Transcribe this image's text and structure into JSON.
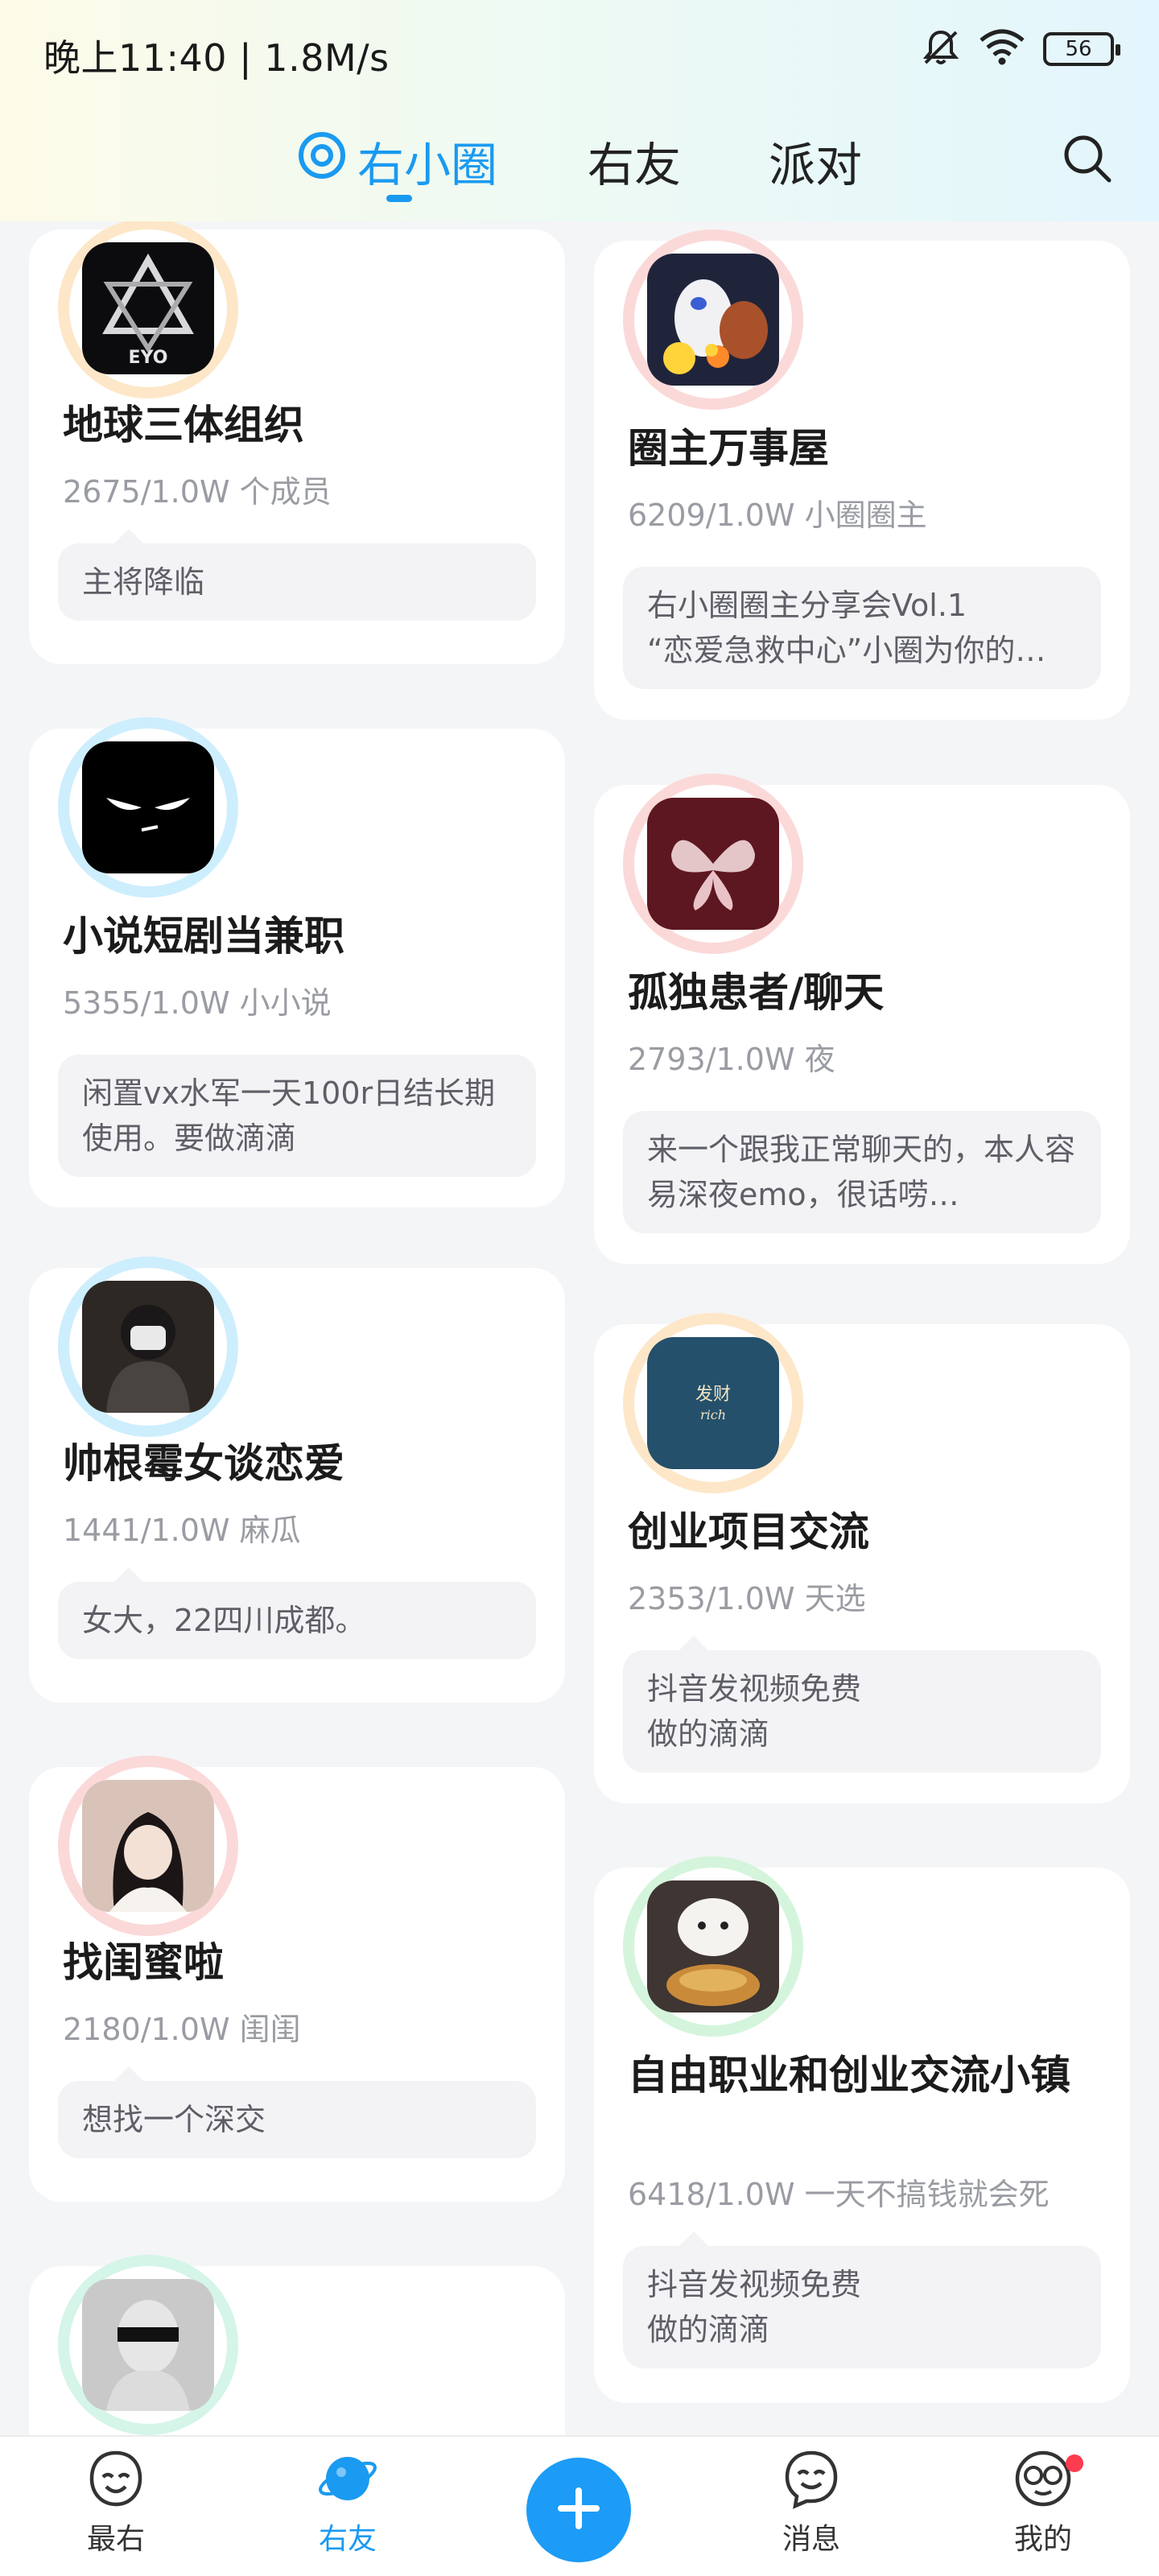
{
  "status_bar": {
    "time": "晚上11:40 | 1.8M/s",
    "battery": "56",
    "icons": [
      "bell-off-icon",
      "wifi-icon",
      "battery-icon"
    ]
  },
  "tabs": [
    {
      "label": "右小圈",
      "active": true
    },
    {
      "label": "右友",
      "active": false
    },
    {
      "label": "派对",
      "active": false
    }
  ],
  "search_icon": "search-icon",
  "accent_color": "#1a9af1",
  "circles": [
    {
      "title": "地球三体组织",
      "meta": "2675/1.0W 个成员",
      "bubble": "主将降临",
      "ring": "#fde7c8"
    },
    {
      "title": "圈主万事屋",
      "meta": "6209/1.0W 小圈圈主",
      "bubble": "右小圈圈主分享会Vol.1\n“恋爱急救中心”小圈为你的…",
      "ring": "#fbd9d9"
    },
    {
      "title": "小说短剧当兼职",
      "meta": "5355/1.0W 小小说",
      "bubble": "闲置vx水军一天100r日结长期使用。要做滴滴",
      "ring": "#cdeefd"
    },
    {
      "title": "孤独患者/聊天",
      "meta": "2793/1.0W 夜",
      "bubble": "来一个跟我正常聊天的，本人容易深夜emo，很话唠…",
      "ring": "#fbd9d9"
    },
    {
      "title": "帅根霉女谈恋爱",
      "meta": "1441/1.0W 麻瓜",
      "bubble": "女大，22四川成都。",
      "ring": "#cdeefd"
    },
    {
      "title": "创业项目交流",
      "meta": "2353/1.0W 天选",
      "bubble": "抖音发视频免费\n做的滴滴",
      "ring": "#fde7c8"
    },
    {
      "title": "找闺蜜啦",
      "meta": "2180/1.0W 闺闺",
      "bubble": "想找一个深交",
      "ring": "#fbd9d9"
    },
    {
      "title": "自由职业和创业交流小镇",
      "meta": "6418/1.0W 一天不搞钱就会死",
      "bubble": "抖音发视频免费\n做的滴滴",
      "ring": "#d4f5dc"
    },
    {
      "title": "",
      "meta": "",
      "bubble": "",
      "ring": "#d4f5e8"
    }
  ],
  "avatar_texts": {
    "eyo": "EYO",
    "rich_cn": "发财",
    "rich_en": "rich"
  },
  "bottom_nav": [
    {
      "label": "最右",
      "icon": "zuiyou-face-icon",
      "active": false
    },
    {
      "label": "右友",
      "icon": "planet-icon",
      "active": true
    },
    {
      "label": "",
      "icon": "plus-icon",
      "active": false
    },
    {
      "label": "消息",
      "icon": "message-face-icon",
      "active": false
    },
    {
      "label": "我的",
      "icon": "profile-glasses-icon",
      "active": false,
      "badge": true
    }
  ]
}
